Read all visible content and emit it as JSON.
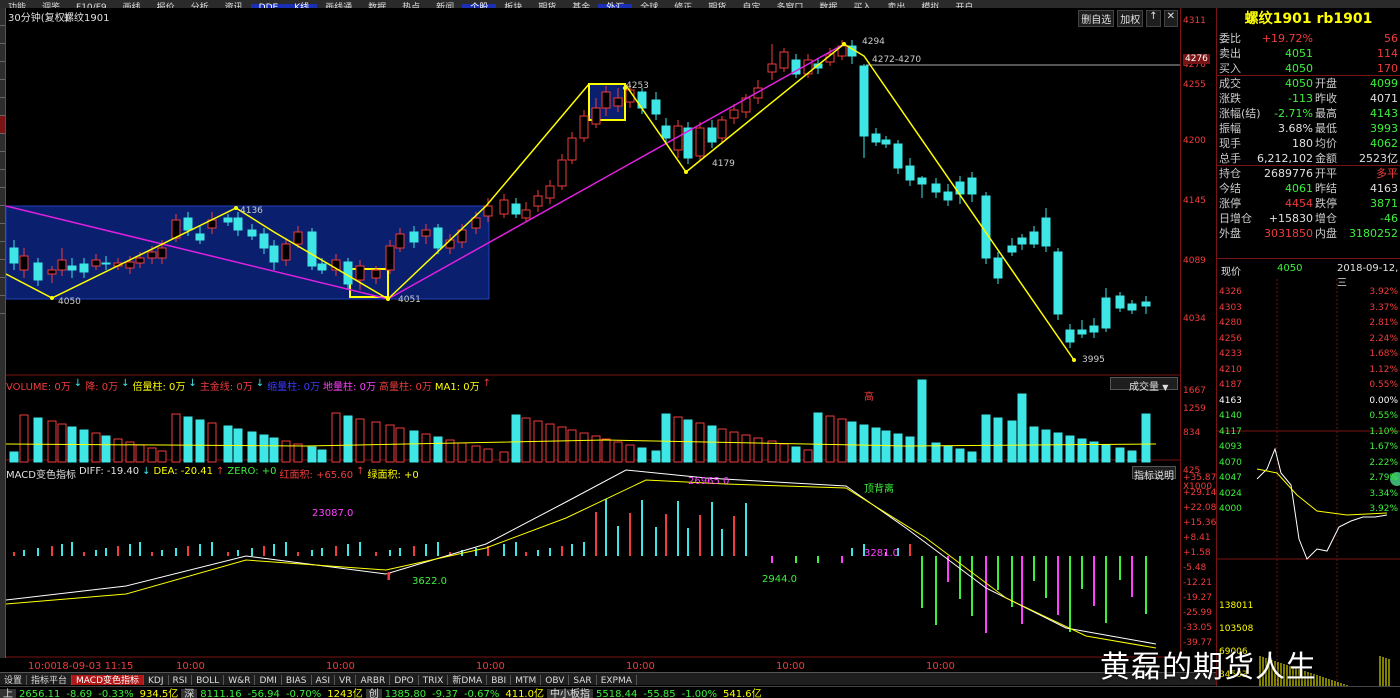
{
  "toolbar": {
    "items": [
      "功能",
      "调鉴",
      "F10/F9",
      "画线",
      "报价",
      "分析",
      "资讯",
      "DDE",
      "K线",
      "画线通",
      "数据",
      "热点",
      "新闻",
      "个股",
      "板块",
      "期货",
      "基金",
      "外汇",
      "全球",
      "修正",
      "期货",
      "自定",
      "多窗口",
      "数据",
      "买入",
      "卖出",
      "模拟",
      "开户"
    ],
    "active": [
      7,
      8,
      13,
      17
    ]
  },
  "chart": {
    "period": "30分钟(复权)",
    "symbol": "螺纹1901",
    "btns": [
      "删自选",
      "加权",
      "↑",
      "✕"
    ],
    "ylabels": [
      "4311",
      "4276",
      "4255",
      "4200",
      "4145",
      "4089",
      "4034"
    ],
    "current_price": "4276",
    "annotations": [
      "4050",
      "4136",
      "4051",
      "4253",
      "4179",
      "4294",
      "4272-4270",
      "3995"
    ]
  },
  "volume": {
    "legend": [
      {
        "t": "VOLUME: 0万",
        "c": "#f03c3c"
      },
      {
        "t": "↓",
        "c": "#3ee6e6"
      },
      {
        "t": "降: 0万",
        "c": "#f03c3c"
      },
      {
        "t": "↓",
        "c": "#3ee6e6"
      },
      {
        "t": "倍量柱: 0万",
        "c": "#ffff00"
      },
      {
        "t": "↓",
        "c": "#3ee6e6"
      },
      {
        "t": "主金线: 0万",
        "c": "#f03c3c"
      },
      {
        "t": "↓",
        "c": "#3ee6e6"
      },
      {
        "t": "缩量柱: 0万",
        "c": "#3c3cff"
      },
      {
        "t": "地量柱: 0万",
        "c": "#ff40ff"
      },
      {
        "t": "高量柱: 0万",
        "c": "#f03c3c"
      },
      {
        "t": "MA1: 0万",
        "c": "#ffff00"
      },
      {
        "t": "↑",
        "c": "#f03c3c"
      }
    ],
    "dropdown": "成交量",
    "ylabels": [
      "1667",
      "1259",
      "834",
      "425",
      "X1000"
    ],
    "high_mark": "高"
  },
  "macd": {
    "legend": [
      {
        "t": "MACD变色指标",
        "c": "#e0e0e0"
      },
      {
        "t": "DIFF: -19.40",
        "c": "#e0e0e0"
      },
      {
        "t": "↓",
        "c": "#3ee6e6"
      },
      {
        "t": "DEA: -20.41",
        "c": "#ffff00"
      },
      {
        "t": "↑",
        "c": "#f03c3c"
      },
      {
        "t": "ZERO: +0",
        "c": "#3cf03c"
      },
      {
        "t": "红面积: +65.60",
        "c": "#f03c3c"
      },
      {
        "t": "↑",
        "c": "#f03c3c"
      },
      {
        "t": "绿面积: +0",
        "c": "#ffff00"
      }
    ],
    "btn": "指标说明",
    "ylabels": [
      "+35.87",
      "+29.14",
      "+22.08",
      "+15.36",
      "+8.41",
      "+1.58",
      "-5.48",
      "-12.21",
      "-19.27",
      "-25.99",
      "-33.05",
      "-39.77"
    ],
    "annotations": [
      "23087.0",
      "3622.0",
      "26965.0",
      "2944.0",
      "3281.0",
      "顶背离"
    ]
  },
  "time_labels": [
    "10:00",
    "18-09-03 11:15",
    "10:00",
    "10:00",
    "10:00",
    "10:00",
    "10:00",
    "10:00"
  ],
  "quote": {
    "title": "螺纹1901 rb1901",
    "rows": [
      [
        "委比",
        "+19.72%",
        "",
        "56"
      ],
      [
        "卖出",
        "4051",
        "",
        "114"
      ],
      [
        "买入",
        "4050",
        "",
        "170"
      ],
      [
        "成交",
        "4050",
        "开盘",
        "4099"
      ],
      [
        "涨跌",
        "-113",
        "昨收",
        "4071"
      ],
      [
        "涨幅(结)",
        "-2.71%",
        "最高",
        "4143"
      ],
      [
        "振幅",
        "3.68%",
        "最低",
        "3993"
      ],
      [
        "现手",
        "180",
        "均价",
        "4062"
      ],
      [
        "总手",
        "6,212,102",
        "金额",
        "2523亿"
      ],
      [
        "持仓",
        "2689776",
        "开平",
        "多平"
      ],
      [
        "今结",
        "4061",
        "昨结",
        "4163"
      ],
      [
        "涨停",
        "4454",
        "跌停",
        "3871"
      ],
      [
        "日增仓",
        "+15830",
        "增仓",
        "-46"
      ],
      [
        "外盘",
        "3031850",
        "内盘",
        "3180252"
      ]
    ]
  },
  "mini": {
    "label": "现价",
    "price": "4050",
    "date": "2018-09-12,三",
    "left": [
      "4326",
      "4303",
      "4280",
      "4256",
      "4233",
      "4210",
      "4187",
      "4163",
      "4140",
      "4117",
      "4093",
      "4070",
      "4047",
      "4024",
      "4000",
      "138011",
      "103508",
      "69006",
      "34503"
    ],
    "right": [
      "3.92%",
      "3.37%",
      "2.81%",
      "2.24%",
      "1.68%",
      "1.12%",
      "0.55%",
      "0.00%",
      "0.55%",
      "1.10%",
      "1.67%",
      "2.22%",
      "2.79%",
      "3.34%",
      "3.92%"
    ]
  },
  "tabs": [
    "设置",
    "指标平台",
    "MACD变色指标",
    "KDJ",
    "RSI",
    "BOLL",
    "W&R",
    "DMI",
    "BIAS",
    "ASI",
    "VR",
    "ARBR",
    "DPO",
    "TRIX",
    "新DMA",
    "BBI",
    "MTM",
    "OBV",
    "SAR",
    "EXPMA"
  ],
  "status": [
    {
      "t": "上",
      "c": "#e0e0e0"
    },
    {
      "t": "2656.11",
      "c": "#3cf03c"
    },
    {
      "t": "-8.69",
      "c": "#3cf03c"
    },
    {
      "t": "-0.33%",
      "c": "#3cf03c"
    },
    {
      "t": "934.5亿",
      "c": "#ffff00"
    },
    {
      "t": "深",
      "c": "#e0e0e0"
    },
    {
      "t": "8111.16",
      "c": "#3cf03c"
    },
    {
      "t": "-56.94",
      "c": "#3cf03c"
    },
    {
      "t": "-0.70%",
      "c": "#3cf03c"
    },
    {
      "t": "1243亿",
      "c": "#ffff00"
    },
    {
      "t": "创",
      "c": "#e0e0e0"
    },
    {
      "t": "1385.80",
      "c": "#3cf03c"
    },
    {
      "t": "-9.37",
      "c": "#3cf03c"
    },
    {
      "t": "-0.67%",
      "c": "#3cf03c"
    },
    {
      "t": "411.0亿",
      "c": "#ffff00"
    },
    {
      "t": "中小板指",
      "c": "#e0e0e0"
    },
    {
      "t": "5518.44",
      "c": "#3cf03c"
    },
    {
      "t": "-55.85",
      "c": "#3cf03c"
    },
    {
      "t": "-1.00%",
      "c": "#3cf03c"
    },
    {
      "t": "541.6亿",
      "c": "#ffff00"
    }
  ],
  "watermark": "黄磊的期货人生",
  "colors": {
    "up": "#f03c3c",
    "down": "#3ee6e6",
    "grid": "#7a1414",
    "box": "#0a1f6e",
    "wave": "#ffff00",
    "trend": "#e020e0"
  }
}
